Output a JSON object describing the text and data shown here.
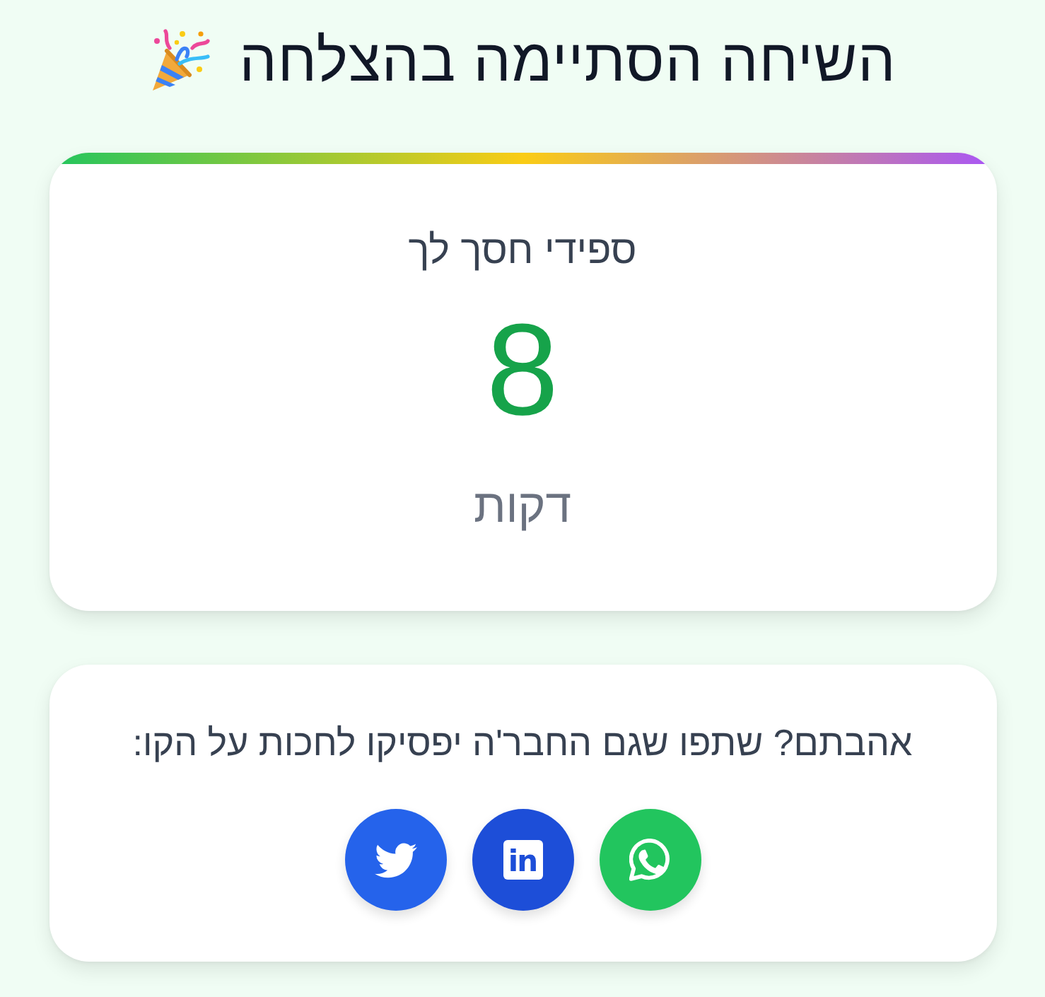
{
  "title": "השיחה הסתיימה בהצלחה",
  "savings": {
    "label": "ספידי חסך לך",
    "value": "8",
    "unit": "דקות"
  },
  "share": {
    "prompt": "אהבתם? שתפו שגם החבר'ה יפסיקו לחכות על הקו:",
    "buttons": [
      {
        "kind": "whatsapp",
        "color": "#22c55e"
      },
      {
        "kind": "linkedin",
        "color": "#1d4ed8",
        "logo_text": "in"
      },
      {
        "kind": "twitter",
        "color": "#2563eb"
      }
    ]
  }
}
